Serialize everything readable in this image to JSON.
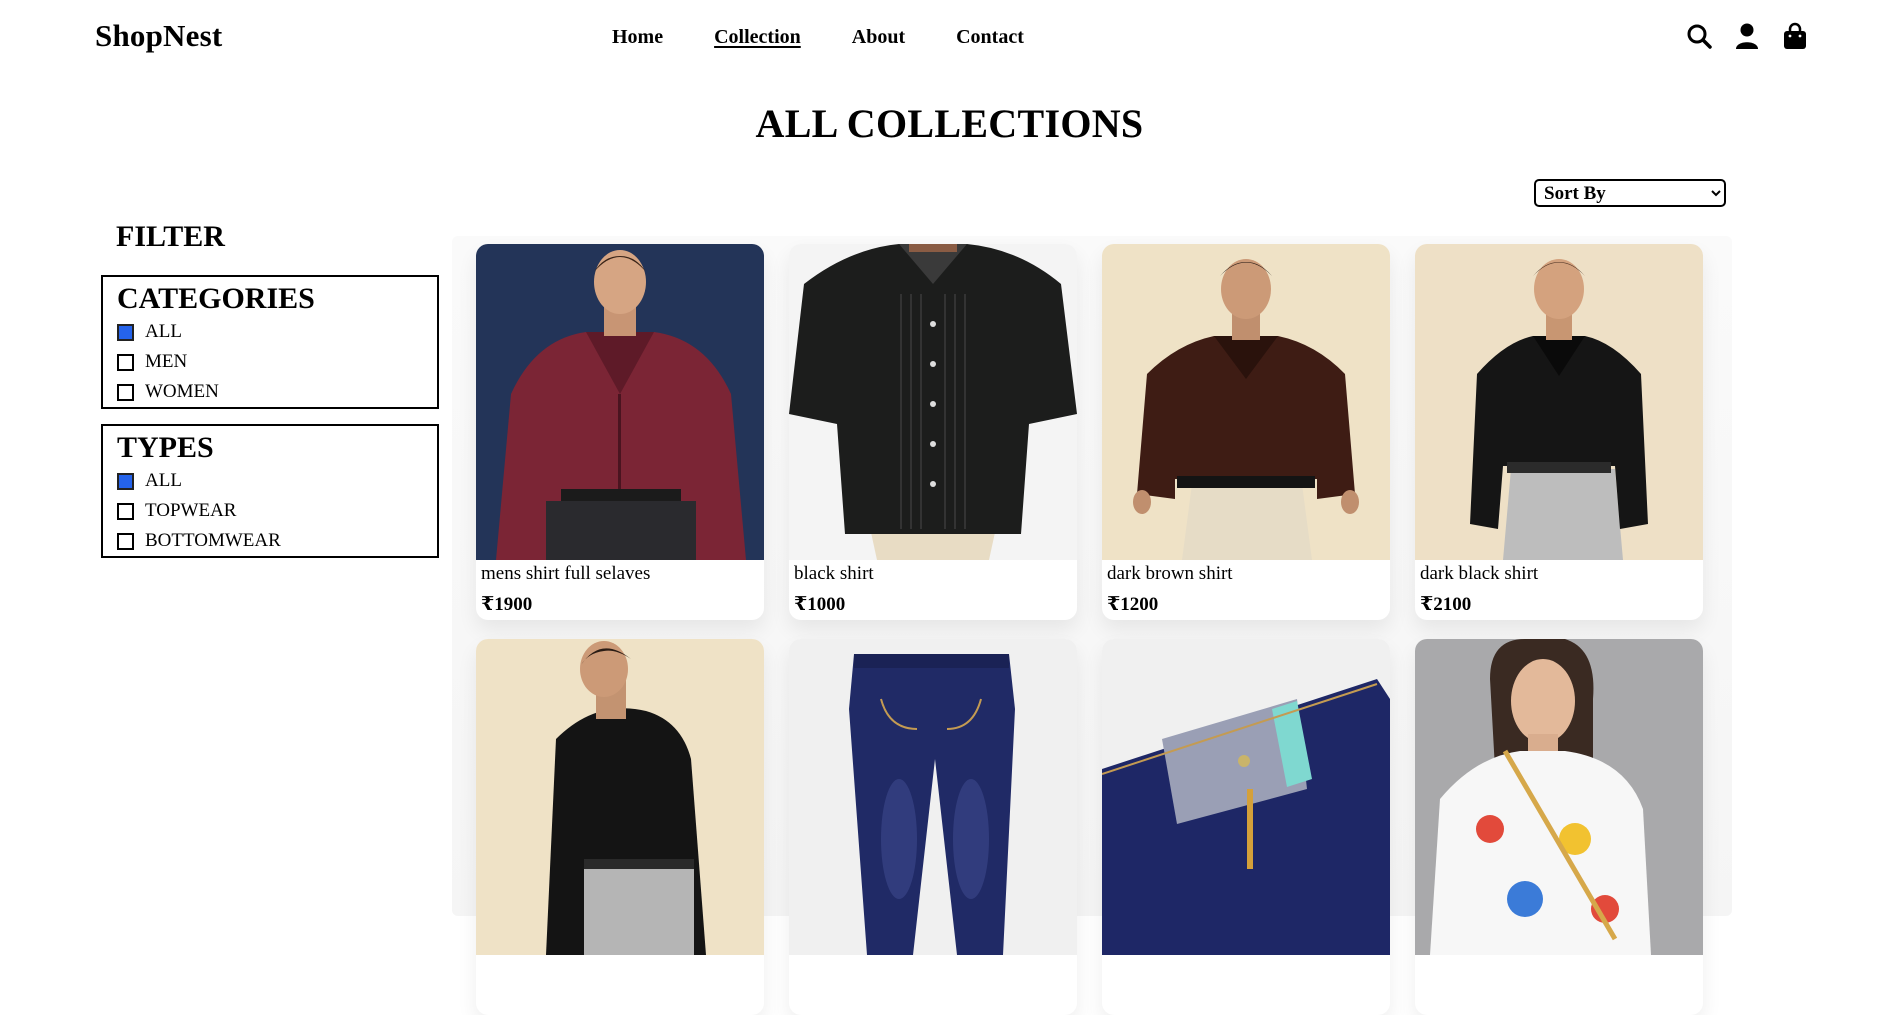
{
  "header": {
    "brand": "ShopNest",
    "nav": [
      "Home",
      "Collection",
      "About",
      "Contact"
    ],
    "active_nav": "Collection",
    "icons": [
      "search-icon",
      "user-icon",
      "shopping-bag-icon"
    ]
  },
  "page_title": "ALL COLLECTIONS",
  "sort": {
    "selected": "Sort By"
  },
  "filter": {
    "title": "FILTER",
    "categories": {
      "title": "CATEGORIES",
      "options": [
        {
          "label": "ALL",
          "checked": true
        },
        {
          "label": "MEN",
          "checked": false
        },
        {
          "label": "WOMEN",
          "checked": false
        }
      ]
    },
    "types": {
      "title": "TYPES",
      "options": [
        {
          "label": "ALL",
          "checked": true
        },
        {
          "label": "TOPWEAR",
          "checked": false
        },
        {
          "label": "BOTTOMWEAR",
          "checked": false
        }
      ]
    }
  },
  "colors": {
    "accent_checkbox": "#2563eb"
  },
  "products": [
    {
      "name": "mens shirt full selaves",
      "price": "₹1900"
    },
    {
      "name": "black shirt",
      "price": "₹1000"
    },
    {
      "name": "dark brown shirt",
      "price": "₹1200"
    },
    {
      "name": "dark black shirt",
      "price": "₹2100"
    },
    {
      "name": "",
      "price": ""
    },
    {
      "name": "",
      "price": ""
    },
    {
      "name": "",
      "price": ""
    },
    {
      "name": "",
      "price": ""
    }
  ]
}
